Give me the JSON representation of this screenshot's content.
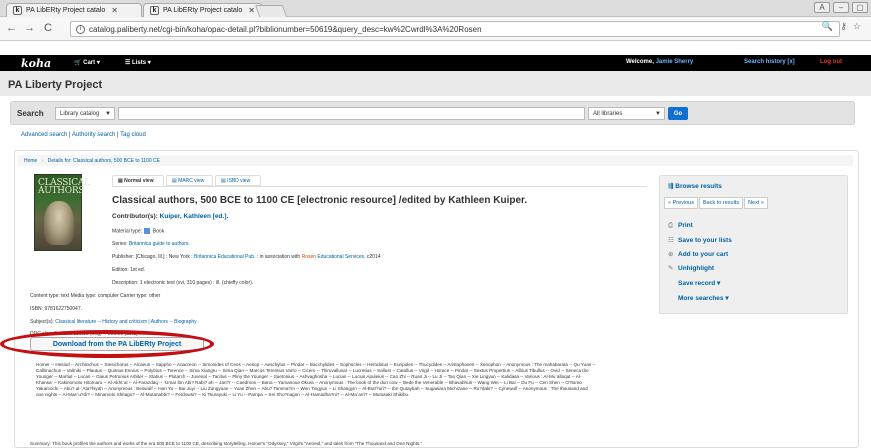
{
  "browser": {
    "tabs": [
      {
        "title": "PA LibERty Project catalo"
      },
      {
        "title": "PA LibERty Project catalo"
      }
    ],
    "url": "catalog.paliberty.net/cgi-bin/koha/opac-detail.pl?biblionumber=50619&query_desc=kw%2Cwrdl%3A%20Rosen"
  },
  "koha": {
    "logo": "koha",
    "cart_label": "Cart",
    "lists_label": "Lists",
    "welcome_prefix": "Welcome,",
    "user_name": "Jamie Sherry",
    "search_history": "Search history [x]",
    "logout": "Log out"
  },
  "library_name": "PA Liberty Project",
  "search": {
    "label": "Search",
    "catalog_select": "Library catalog",
    "library_select": "All libraries",
    "go": "Go"
  },
  "links": {
    "advanced": "Advanced search",
    "authority": "Authority search",
    "tag_cloud": "Tag cloud"
  },
  "breadcrumb": {
    "home": "Home",
    "details": "Details for: Classical authors, 500 BCE to 1100 CE"
  },
  "cover_text": "CLASSICAL AUTHORS",
  "view_tabs": [
    "Normal view",
    "MARC view",
    "ISBD view"
  ],
  "record": {
    "title": "Classical authors, 500 BCE to 1100 CE [electronic resource] /edited by Kathleen Kuiper.",
    "contributor_label": "Contributor(s):",
    "contributor": "Kuiper, Kathleen [ed.].",
    "material_type_label": "Material type:",
    "material_type": "Book",
    "series_label": "Series:",
    "series": "Britannica guide to authors.",
    "publisher_label": "Publisher:",
    "publisher_pre": "[Chicago, Ill.] : New York :",
    "publisher_a": "Britannica Educational Pub.",
    "publisher_mid": ": in association with",
    "publisher_hl": "Rosen",
    "publisher_b": "Educational Services,",
    "publisher_year": "c2014",
    "edition_label": "Edition:",
    "edition": "1st ed.",
    "description_label": "Description:",
    "description": "1 electronic text (xvi, 310 pages) : ill. (chiefly color).",
    "content_type": "Content type: text Media type: computer Carrier type: other",
    "isbn": "ISBN: 9781622750047.",
    "subjects_label": "Subject(s):",
    "subjects": "Classical literature -- History and criticism | Authors -- Biography",
    "ddc": "DDC classification: 880.09 (eng) -- 880.09 (23rd)"
  },
  "download_label": "Download from the PA LibERty Project",
  "contents_text": "Homer -- Hesiod -- Archilochus -- Stesichorus -- Alcaeus -- Sappho -- Anacreon -- Simonides of Ceos -- Aesop -- Aeschylus -- Pindar -- Bacchylides -- Sophocles -- Herodotus -- Euripides -- Thucydides -- Aristophanes -- Xenophon -- Anonymous : The mahabarata -- Qu Yuan -- Callimachus -- Valmiki -- Plautus -- Quintus Ennius -- Polybius -- Terence -- Sima Xiangru -- Sima Qian -- Marcus Terentius Varro -- Cicero -- Thiruvalluvar -- Lucretius -- Sallust -- Catullus -- Virgil -- Horace -- Pindar -- Sextus Propertius -- Albius Tibullus -- Ovid -- Seneca the Younger -- Martial -- Lucan -- Gaius Petronius Arbiter -- Statius -- Plutarch -- Juvenal -- Tacitus -- Pliny the Younger -- Suetonius -- Ashvaghosha -- Lucian -- Lucius Apuleius -- Cao Zhi -- Ruan Ji -- Lu Ji -- Tao Qian -- Xie Lingyun -- Kalidasa -- Various : Al-Mu`allaqat -- Al-Khansa' -- Kakinomoto Hitomaro -- Al-Akht`al -- Al-Farazdaq -- `Umar ibn Abi? Rabi? ah -- Jari?r -- Caedmon -- Bana -- Yamanoue Okura -- Anonymous : The book of the dun cow -- Bede the Venerable -- Bhavabhuti -- Wang Wei -- Li Bai -- Du Fu -- Cen Shen -- O?tomo Yakamochi -- Abu? al-`Ata?hiyah -- Anonymous : Beowulf -- Han Yu -- Bai Juyi -- Liu Zongyuan -- Yuan Zhen -- Abu? Tamma?m -- Wen Tingyun -- Li Shangyin -- Al-Butr?uri? -- Ibn Qutaybah -- Sugawara Michizane -- Ru?daki? -- Cynewulf -- Anonymous : The thousand and one nights -- Al-Mas`u?di? -- Minamoto Shitago? -- Al-Mutanabbi? -- Ferdowsi? -- Ki Tsurayuki -- Li Yu -- Pampa -- Sei Sho?nagon -- Al-Hamadha?ni? -- Al-Ma`arri? -- Murasaki Shikibu.",
  "summary_text": "Summary: This book profiles the authors and works of the era 500 BCE to 1100 CE, describing storytelling, Homer's \"Odyssey,\" Virgil's \"Aeneid,\" and tales from \"The Thousand and One Nights.\"",
  "sidebar": {
    "browse_results": "Browse results",
    "previous": "« Previous",
    "back": "Back to results",
    "next": "Next »",
    "print": "Print",
    "save_lists": "Save to your lists",
    "add_cart": "Add to your cart",
    "unhighlight": "Unhighlight",
    "save_record": "Save record",
    "more_searches": "More searches"
  },
  "colors": {
    "link": "#0061a6",
    "go_button": "#0f6fd2",
    "annotation_ring": "#c40f12",
    "nav_bg": "#000000"
  }
}
